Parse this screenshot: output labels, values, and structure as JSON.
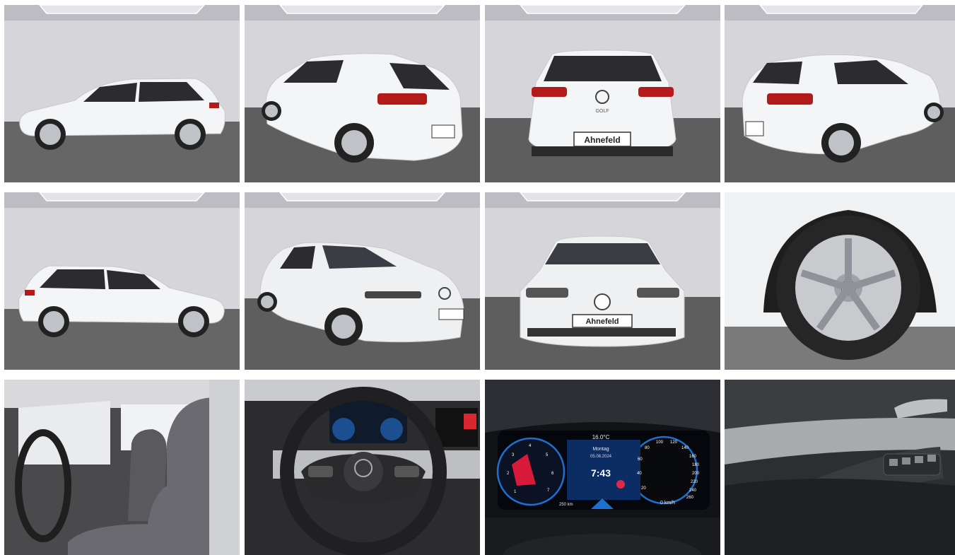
{
  "gallery": {
    "images": [
      {
        "view": "side-left"
      },
      {
        "view": "rear-three-quarter-left"
      },
      {
        "view": "rear"
      },
      {
        "view": "rear-three-quarter-right"
      },
      {
        "view": "side-right"
      },
      {
        "view": "front-three-quarter-left"
      },
      {
        "view": "front"
      },
      {
        "view": "wheel-detail"
      },
      {
        "view": "interior-front-seats"
      },
      {
        "view": "steering-wheel-cockpit"
      },
      {
        "view": "digital-instrument-cluster"
      },
      {
        "view": "door-panel-controls"
      }
    ]
  },
  "car": {
    "plate": "Ahnefeld",
    "model_badge": "GOLF",
    "body_color": "#f4f5f6"
  },
  "cluster": {
    "temperature": "16.0°C",
    "day": "Montag",
    "date": "05.08.2024",
    "time": "7:43",
    "range": "250 km",
    "speed": "0 km/h",
    "speed_ticks": [
      "20",
      "40",
      "60",
      "80",
      "100",
      "120",
      "140",
      "160",
      "180",
      "200",
      "220",
      "240",
      "260"
    ],
    "rpm_ticks": [
      "1",
      "2",
      "3",
      "4",
      "5",
      "6",
      "7"
    ]
  },
  "colors": {
    "studio_wall": "#d9d8de",
    "studio_floor": "#6b6b6b",
    "cluster_blue": "#2f7fd6"
  }
}
